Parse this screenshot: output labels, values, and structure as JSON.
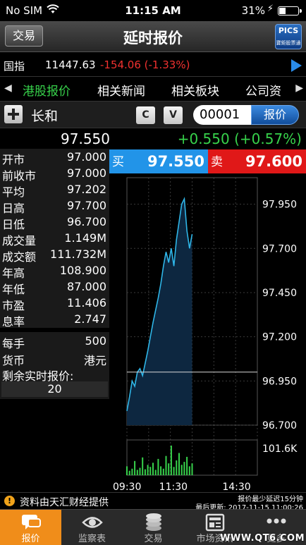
{
  "status_bar": {
    "carrier": "No SIM",
    "time": "11:15 AM",
    "battery": "31%"
  },
  "header": {
    "trade_button": "交易",
    "title": "延时报价",
    "logo_text": "寶鉅股票通"
  },
  "index": {
    "name": "国指",
    "value": "11447.63",
    "change": "-154.06 (-1.33%)"
  },
  "tabs": [
    {
      "label": "港股报价"
    },
    {
      "label": "相关新闻"
    },
    {
      "label": "相关板块"
    },
    {
      "label": "公司资"
    }
  ],
  "stock": {
    "name": "长和",
    "btn_c": "C",
    "btn_v": "V",
    "code": "00001",
    "quote_button": "报价"
  },
  "price": {
    "last": "97.550",
    "change": "+0.550 (+0.57%)"
  },
  "stats": [
    {
      "label": "开市",
      "value": "97.000"
    },
    {
      "label": "前收市",
      "value": "97.000"
    },
    {
      "label": "平均",
      "value": "97.202"
    },
    {
      "label": "日高",
      "value": "97.700"
    },
    {
      "label": "日低",
      "value": "96.700"
    },
    {
      "label": "成交量",
      "value": "1.149M"
    },
    {
      "label": "成交额",
      "value": "111.732M"
    },
    {
      "label": "年高",
      "value": "108.900"
    },
    {
      "label": "年低",
      "value": "87.000"
    },
    {
      "label": "市盈",
      "value": "11.406"
    },
    {
      "label": "息率",
      "value": "2.747"
    }
  ],
  "lot": {
    "label": "每手",
    "value": "500"
  },
  "currency": {
    "label": "货币",
    "value": "港元"
  },
  "remaining": {
    "label": "剩余实时报价:",
    "value": "20"
  },
  "bid": {
    "label": "买",
    "value": "97.550"
  },
  "ask": {
    "label": "卖",
    "value": "97.600"
  },
  "chart_data": {
    "type": "line",
    "y_ticks": [
      "97.950",
      "97.700",
      "97.450",
      "97.200",
      "96.950",
      "96.700"
    ],
    "ylim": [
      96.7,
      98.1
    ],
    "reference": 97.0,
    "x_ticks": [
      "09:30",
      "11:30",
      "14:30"
    ],
    "volume_label": "101.6K",
    "price": [
      96.78,
      96.86,
      96.95,
      96.92,
      97.0,
      97.02,
      96.98,
      97.05,
      97.12,
      97.2,
      97.28,
      97.35,
      97.42,
      97.5,
      97.6,
      97.68,
      97.62,
      97.7,
      97.6,
      97.75,
      97.85,
      97.95,
      97.98,
      97.8,
      97.7,
      97.78
    ],
    "volume": [
      30,
      15,
      22,
      48,
      18,
      25,
      60,
      20,
      35,
      28,
      42,
      18,
      55,
      30,
      22,
      65,
      40,
      100,
      28,
      50,
      75,
      35,
      45,
      62,
      30,
      40
    ]
  },
  "info": {
    "source": "资料由天汇财经提供",
    "delay": "报价最少延迟15分钟",
    "updated": "最后更新: 2017-11-15 11:00:26"
  },
  "tabbar": [
    {
      "label": "报价"
    },
    {
      "label": "监察表"
    },
    {
      "label": "交易"
    },
    {
      "label": "市场资讯"
    },
    {
      "label": "更多"
    }
  ],
  "watermark": "WWW.QT6.COM"
}
